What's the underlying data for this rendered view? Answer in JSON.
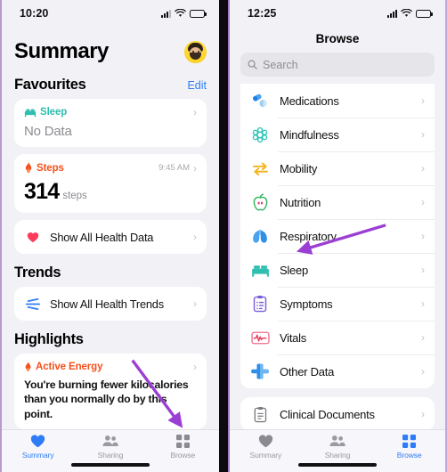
{
  "left_phone": {
    "status_bar": {
      "time": "10:20",
      "cellular": "signal-bars",
      "wifi": "wifi-icon",
      "battery": "battery-low"
    },
    "page_title": "Summary",
    "avatar_name": "profile-avatar",
    "sections": {
      "favourites": {
        "title": "Favourites",
        "edit_label": "Edit",
        "cards": [
          {
            "icon": "bed-icon",
            "label": "Sleep",
            "value": "No Data",
            "unit": "",
            "time": ""
          },
          {
            "icon": "flame-icon",
            "label": "Steps",
            "value": "314",
            "unit": "steps",
            "time": "9:45 AM"
          }
        ],
        "link": {
          "icon": "heart-icon",
          "label": "Show All Health Data"
        }
      },
      "trends": {
        "title": "Trends",
        "link": {
          "icon": "trends-icon",
          "label": "Show All Health Trends"
        }
      },
      "highlights": {
        "title": "Highlights",
        "card": {
          "icon": "flame-icon",
          "label": "Active Energy",
          "text": "You're burning fewer kilocalories than you normally do by this point."
        }
      }
    },
    "tabs": [
      {
        "name": "summary",
        "label": "Summary",
        "icon": "heart-icon",
        "active": true
      },
      {
        "name": "sharing",
        "label": "Sharing",
        "icon": "people-icon",
        "active": false
      },
      {
        "name": "browse",
        "label": "Browse",
        "icon": "grid-icon",
        "active": false
      }
    ]
  },
  "right_phone": {
    "status_bar": {
      "time": "12:25",
      "cellular": "signal-bars",
      "wifi": "wifi-icon",
      "battery": "battery-full"
    },
    "nav_title": "Browse",
    "search": {
      "placeholder": "Search",
      "icon": "search-icon"
    },
    "health_categories": [
      {
        "icon": "pills-icon",
        "label": "Medications"
      },
      {
        "icon": "brain-icon",
        "label": "Mindfulness"
      },
      {
        "icon": "arrows-icon",
        "label": "Mobility"
      },
      {
        "icon": "apple-icon",
        "label": "Nutrition"
      },
      {
        "icon": "lungs-icon",
        "label": "Respiratory"
      },
      {
        "icon": "bed-icon",
        "label": "Sleep"
      },
      {
        "icon": "clipboard-icon",
        "label": "Symptoms"
      },
      {
        "icon": "waveform-icon",
        "label": "Vitals"
      },
      {
        "icon": "plus-icon",
        "label": "Other Data"
      }
    ],
    "documents": [
      {
        "icon": "document-icon",
        "label": "Clinical Documents"
      }
    ],
    "tabs": [
      {
        "name": "summary",
        "label": "Summary",
        "icon": "heart-icon",
        "active": false
      },
      {
        "name": "sharing",
        "label": "Sharing",
        "icon": "people-icon",
        "active": false
      },
      {
        "name": "browse",
        "label": "Browse",
        "icon": "grid-icon",
        "active": true
      }
    ]
  },
  "annotations": {
    "arrow_color": "#9b3fd4",
    "arrows": [
      {
        "name": "arrow-to-browse-tab",
        "points_to": "Browse"
      },
      {
        "name": "arrow-to-sleep-row",
        "points_to": "Sleep"
      }
    ]
  },
  "colors": {
    "accent_blue": "#2f7df6",
    "sleep_teal": "#2fbfae",
    "steps_orange": "#f4511e",
    "screen_bg": "#f2f1f6",
    "card_bg": "#ffffff"
  }
}
